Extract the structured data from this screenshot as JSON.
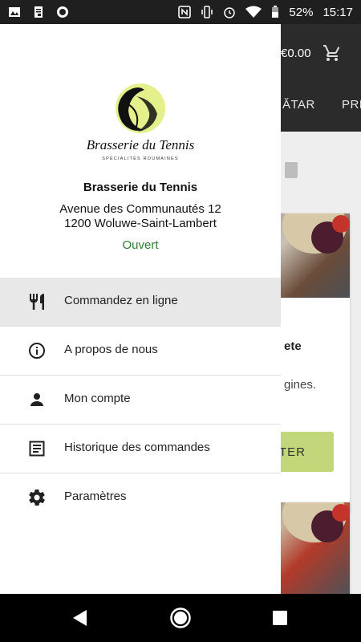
{
  "status_bar": {
    "battery": "52%",
    "time": "15:17",
    "left_icons": [
      "image-icon",
      "clipboard-icon",
      "circle-icon"
    ],
    "right_icons": [
      "nfc-icon",
      "vibrate-icon",
      "alarm-icon",
      "wifi-icon",
      "battery-icon"
    ]
  },
  "background_app": {
    "cart_total": "€0.00",
    "tabs": [
      "ĂTAR",
      "PRE"
    ],
    "card_title_fragment": "ete",
    "card_text_fragment": "gines.",
    "card_button_fragment": "TER"
  },
  "drawer": {
    "logo_text": "Brasserie du Tennis",
    "logo_tagline": "SPÉCIALITÉS ROUMAINES",
    "restaurant_name": "Brasserie du Tennis",
    "address_line1": "Avenue des Communautés 12",
    "address_line2": "1200 Woluwe-Saint-Lambert",
    "status": "Ouvert",
    "menu": [
      {
        "label": "Commandez en ligne",
        "icon": "restaurant-icon",
        "active": true
      },
      {
        "label": "A propos de nous",
        "icon": "info-icon",
        "active": false
      },
      {
        "label": "Mon compte",
        "icon": "person-icon",
        "active": false
      },
      {
        "label": "Historique des commandes",
        "icon": "receipt-icon",
        "active": false
      },
      {
        "label": "Paramètres",
        "icon": "settings-icon",
        "active": false
      }
    ]
  },
  "colors": {
    "status_open": "#2e7d32",
    "active_item_bg": "#e8e8e8",
    "header_bar": "#2b2b2b",
    "add_button": "#c2d77a"
  }
}
